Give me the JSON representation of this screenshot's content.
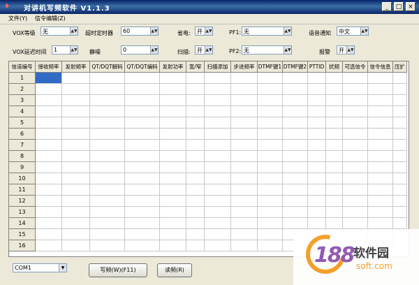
{
  "window": {
    "title": "对讲机写频软件  V1.1.3"
  },
  "menu": [
    "文件(Y)",
    "信令编辑(Z)"
  ],
  "settings": {
    "vox_level": {
      "label": "VOX等级",
      "value": "无"
    },
    "timeout": {
      "label": "超时定时器",
      "value": "60"
    },
    "power_save": {
      "label": "省电:",
      "value": "开"
    },
    "pf1": {
      "label": "PF1:",
      "value": "无"
    },
    "voice": {
      "label": "语音通知",
      "value": "中文"
    },
    "vox_delay": {
      "label": "VOX延迟时间",
      "value": "1"
    },
    "squelch": {
      "label": "静噪",
      "value": "0"
    },
    "scan": {
      "label": "扫描:",
      "value": "开"
    },
    "pf2": {
      "label": "PF2:",
      "value": "无"
    },
    "alarm": {
      "label": "报警",
      "value": "开"
    }
  },
  "table": {
    "columns": [
      "信道编号",
      "接收频率",
      "发射频率",
      "QT/DQT解码",
      "QT/DQT编码",
      "发射功率",
      "宽/窄",
      "扫描添加",
      "步进频率",
      "DTMF键1",
      "DTMF键2",
      "PTTID",
      "扰频",
      "可选信令",
      "信令信息",
      "压扩"
    ],
    "rows": [
      "1",
      "2",
      "3",
      "4",
      "5",
      "6",
      "7",
      "8",
      "9",
      "10",
      "11",
      "12",
      "13",
      "14",
      "15",
      "16"
    ]
  },
  "footer": {
    "port": "COM1",
    "write_label": "写频(W)(F11)",
    "read_label": "读频(R)"
  },
  "watermark": {
    "number": "188",
    "name": "软件园",
    "url": "soft.com"
  }
}
